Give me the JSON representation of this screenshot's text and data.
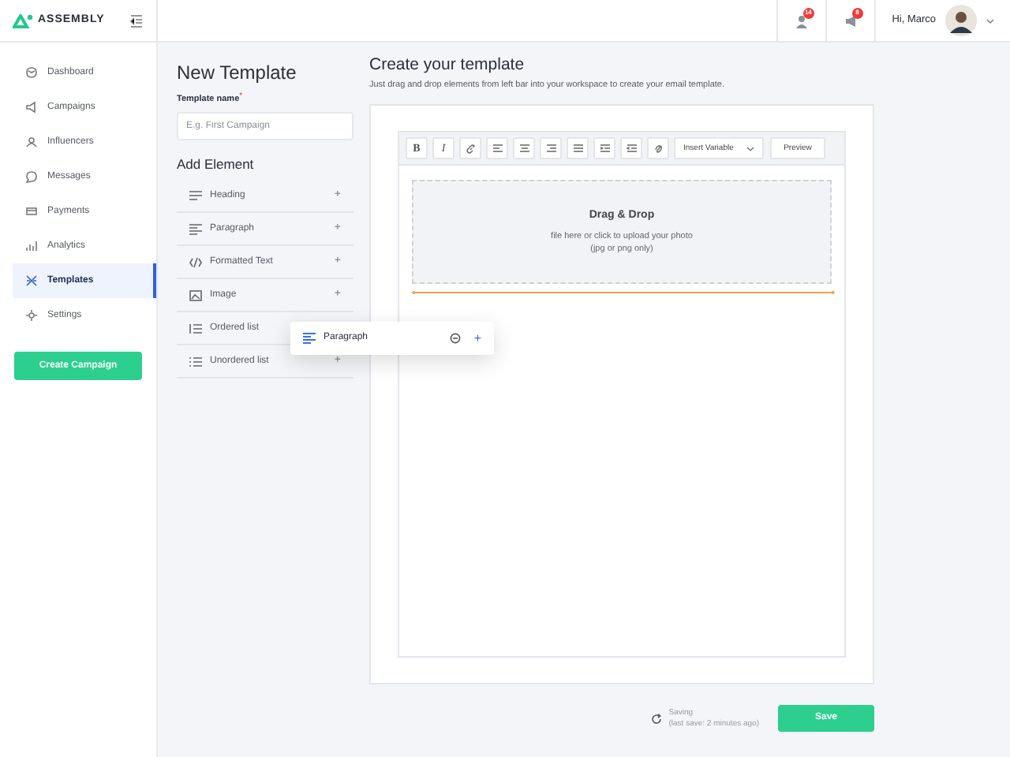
{
  "brand": "ASSEMBLY",
  "header": {
    "notifications": [
      {
        "count": "14"
      },
      {
        "count": "8"
      }
    ],
    "greeting": "Hi, Marco"
  },
  "sidebar": {
    "items": [
      {
        "label": "Dashboard",
        "selected": false
      },
      {
        "label": "Campaigns",
        "selected": false
      },
      {
        "label": "Influencers",
        "selected": false
      },
      {
        "label": "Messages",
        "selected": false
      },
      {
        "label": "Payments",
        "selected": false
      },
      {
        "label": "Analytics",
        "selected": false
      },
      {
        "label": "Templates",
        "selected": true
      },
      {
        "label": "Settings",
        "selected": false
      }
    ],
    "button": "Create Campaign"
  },
  "panel": {
    "title": "New Template",
    "field_label": "Template name",
    "required_mark": "*",
    "placeholder": "E.g. First Campaign",
    "section": "Add Element",
    "elements": [
      {
        "label": "Heading",
        "add": "+"
      },
      {
        "label": "Paragraph",
        "add": "+"
      },
      {
        "label": "Formatted Text",
        "add": "+"
      },
      {
        "label": "Image",
        "add": "+"
      },
      {
        "label": "Ordered list"
      },
      {
        "label": "Unordered list",
        "add": "+"
      }
    ]
  },
  "dragging": {
    "label": "Paragraph",
    "add": "+"
  },
  "editor": {
    "title": "Create your template",
    "subtitle": "Just drag and drop elements from left bar into your workspace to create your email template.",
    "toolbar": {
      "bold": "B",
      "italic": "I",
      "dropdown": "Insert Variable",
      "preview": "Preview"
    },
    "dropzone": {
      "title": "Drag & Drop",
      "line1": "file here or click to upload your photo",
      "line2": "(jpg or png only)"
    }
  },
  "footer": {
    "status": "Saving",
    "last_save": "(last save: 2 minutes ago)",
    "save": "Save"
  }
}
